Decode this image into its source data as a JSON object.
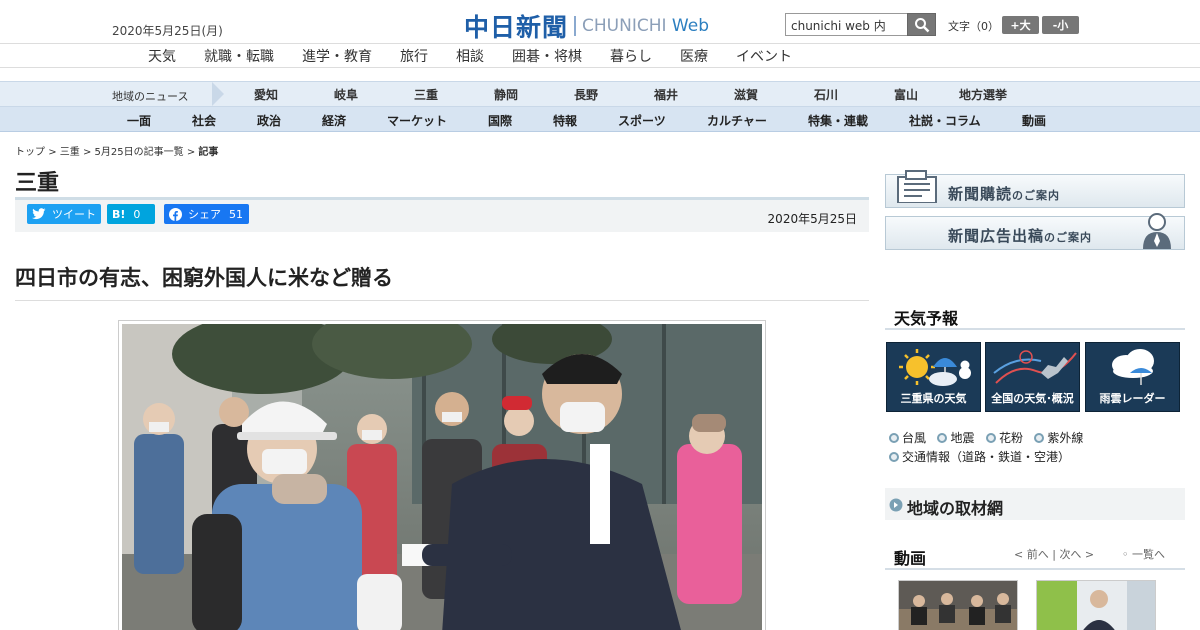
{
  "header": {
    "date": "2020年5月25日(月)",
    "logo_jp": "中日新聞",
    "logo_en_main": "CHUNICHI",
    "logo_en_web": "Web",
    "search_value": "chunichi web 内",
    "text_size_label": "文字（0）",
    "size_up": "+大",
    "size_down": "-小"
  },
  "category_nav": [
    "天気",
    "就職・転職",
    "進学・教育",
    "旅行",
    "相談",
    "囲碁・将棋",
    "暮らし",
    "医療",
    "イベント"
  ],
  "region_nav": {
    "label": "地域のニュース",
    "items": [
      "愛知",
      "岐阜",
      "三重",
      "静岡",
      "長野",
      "福井",
      "滋賀",
      "石川",
      "富山",
      "地方選挙"
    ]
  },
  "section_nav": [
    "一面",
    "社会",
    "政治",
    "経済",
    "マーケット",
    "国際",
    "特報",
    "スポーツ",
    "カルチャー",
    "特集・連載",
    "社説・コラム",
    "動画"
  ],
  "breadcrumb": {
    "items": [
      "トップ",
      "三重",
      "5月25日の記事一覧"
    ],
    "current": "記事",
    "sep": ">"
  },
  "article": {
    "section_title": "三重",
    "tweet_label": "ツイート",
    "hatena_label": "B!",
    "hatena_count": "0",
    "fb_label": "シェア",
    "fb_count": "51",
    "date": "2020年5月25日",
    "headline": "四日市の有志、困窮外国人に米など贈る"
  },
  "sidebar": {
    "banner_subscribe": "新聞購読",
    "banner_subscribe_suffix": "のご案内",
    "banner_ads": "新聞広告出稿",
    "banner_ads_suffix": "のご案内",
    "weather_heading": "天気予報",
    "weather_tiles": [
      "三重県の天気",
      "全国の天気･概況",
      "雨雲レーダー"
    ],
    "weather_links_row1": [
      "台風",
      "地震",
      "花粉",
      "紫外線"
    ],
    "weather_links_row2": "交通情報（道路・鉄道・空港）",
    "news_network": "地域の取材網",
    "video_heading": "動画",
    "video_prev": "< 前へ",
    "video_next": "次へ >",
    "video_sep": "|",
    "video_list": "一覧へ"
  },
  "colors": {
    "brand_blue": "#1f5fa8",
    "twitter": "#1da1f2",
    "hatena": "#00a4de",
    "facebook": "#1877f2",
    "region_bg": "#e4edf6",
    "section_bg": "#d7e4f2"
  }
}
